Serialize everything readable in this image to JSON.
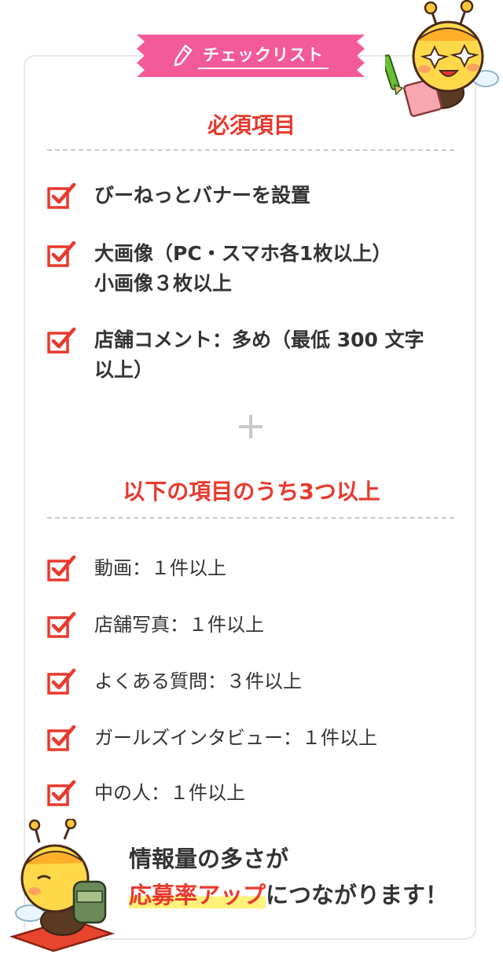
{
  "header": {
    "badge_label": "チェックリスト"
  },
  "required": {
    "title": "必須項目",
    "items": [
      {
        "lines": [
          "びーねっとバナーを設置"
        ]
      },
      {
        "lines": [
          "大画像（PC・スマホ各1枚以上）",
          "小画像３枚以上"
        ]
      },
      {
        "lines": [
          "店舗コメント：多め（最低 300 文字",
          "以上）"
        ]
      }
    ]
  },
  "optional": {
    "title": "以下の項目のうち3つ以上",
    "items": [
      "動画：１件以上",
      "店舗写真：１件以上",
      "よくある質問：３件以上",
      "ガールズインタビュー：１件以上",
      "中の人：１件以上"
    ]
  },
  "footer": {
    "line1": "情報量の多さが",
    "highlight": "応募率アップ",
    "line2_rest": "につながります！"
  },
  "colors": {
    "accent_red": "#e8392e",
    "ribbon_pink": "#f25a9a",
    "highlight_yellow": "#fff27a"
  }
}
